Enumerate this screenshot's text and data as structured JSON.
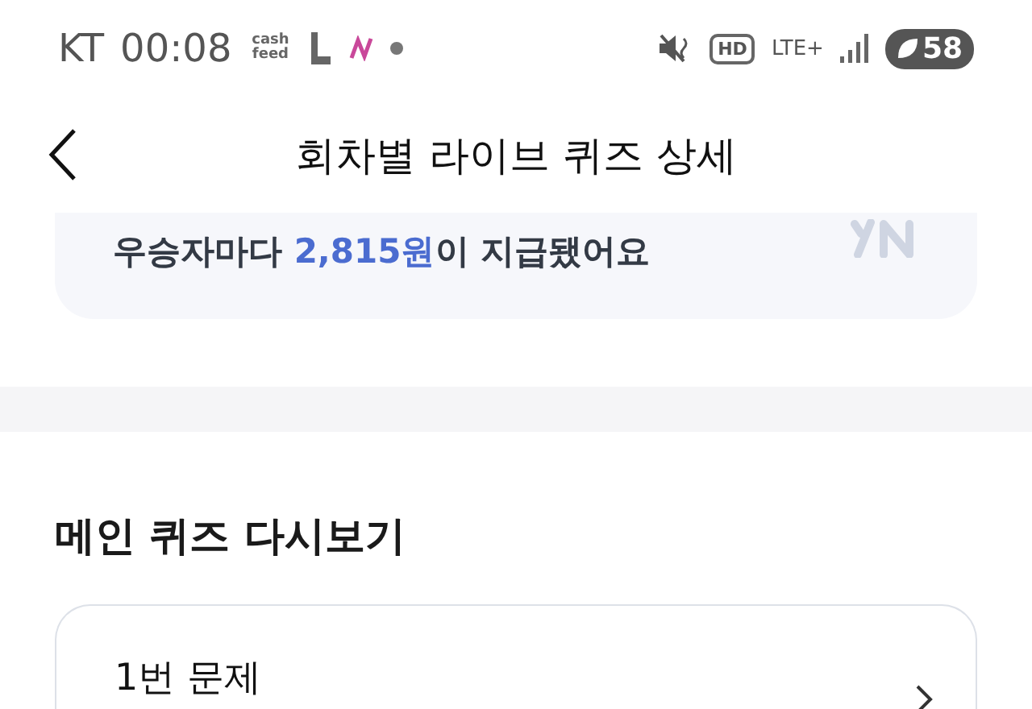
{
  "status_bar": {
    "carrier": "KT",
    "time": "00:08",
    "app_badge": "cash feed",
    "hd": "HD",
    "network": "LTE+",
    "battery": "58"
  },
  "header": {
    "title": "회차별 라이브 퀴즈 상세"
  },
  "banner": {
    "text": "우승자마다 **2,815원**이 지급됐어요"
  },
  "section": {
    "title": "메인 퀴즈 다시보기"
  },
  "quiz_items": [
    {
      "label": "1번 문제"
    }
  ]
}
